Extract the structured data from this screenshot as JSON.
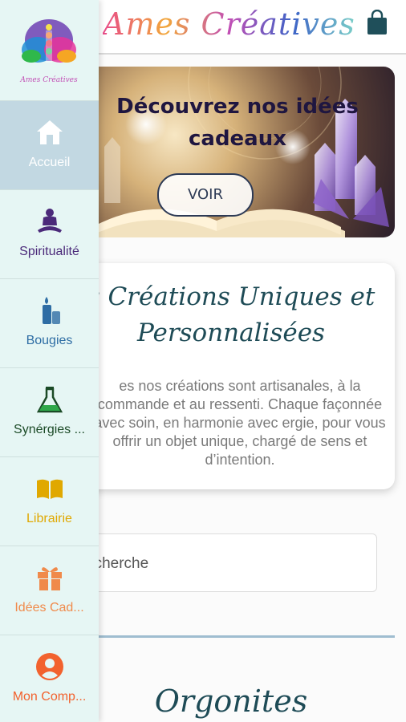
{
  "header": {
    "brand": "Ames Créatives",
    "cart_icon": "shopping-bag-icon"
  },
  "sidebar": {
    "logo_text": "Ames Créatives",
    "items": [
      {
        "label": "Accueil",
        "icon": "home-icon",
        "color": "#ffffff",
        "active": true
      },
      {
        "label": "Spiritualité",
        "icon": "meditation-icon",
        "color": "#4b2a7a"
      },
      {
        "label": "Bougies",
        "icon": "candle-icon",
        "color": "#2e6da4"
      },
      {
        "label": "Synérgies ...",
        "icon": "flask-icon",
        "color": "#1b4a26"
      },
      {
        "label": "Librairie",
        "icon": "book-icon",
        "color": "#e0a800"
      },
      {
        "label": "Idées Cad...",
        "icon": "gift-icon",
        "color": "#f08a4b"
      },
      {
        "label": "Mon Comp...",
        "icon": "user-icon",
        "color": "#f2622e"
      }
    ]
  },
  "banner": {
    "title": "Découvrez nos idées cadeaux",
    "button": "VOIR"
  },
  "intro": {
    "title": "s Créations Uniques et Personnalisées",
    "text": "es nos créations sont artisanales, à la commande et au ressenti. Chaque façonnée avec soin, en harmonie avec ergie, pour vous offrir un objet unique, chargé de sens et d’intention."
  },
  "search": {
    "placeholder": "echerche"
  },
  "section": {
    "title": "Orgonites"
  },
  "colors": {
    "sidebar_bg": "#e6f6f4",
    "active_bg": "#c2d8e2",
    "heading": "#1e4b56"
  }
}
